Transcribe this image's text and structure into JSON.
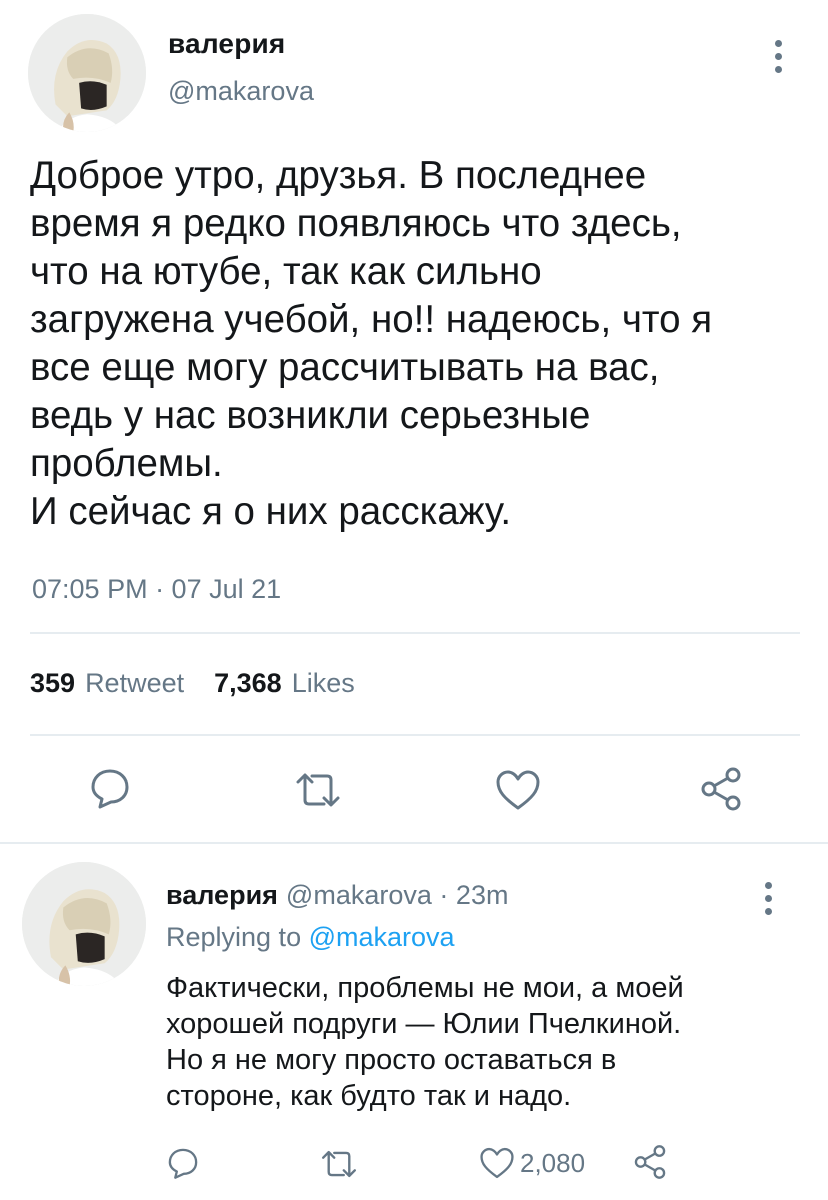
{
  "colors": {
    "text": "#14171a",
    "secondary": "#657786",
    "accent": "#1da1f2",
    "divider": "#e6ecf0"
  },
  "main_tweet": {
    "author_name": "валерия",
    "author_handle": "@makarova",
    "text": "Доброе утро, друзья. В последнее\nвремя я редко появляюсь что здесь,\nчто на ютубе, так как сильно\nзагружена учебой, но!! надеюсь, что я\nвсе еще могу рассчитывать на вас,\nведь у нас возникли серьезные\nпроблемы.\nИ сейчас я о них расскажу.",
    "timestamp": "07:05 PM · 07 Jul 21",
    "retweet_count": "359",
    "retweet_label": "Retweet",
    "like_count": "7,368",
    "like_label": "Likes",
    "icons": [
      "more-vertical-icon",
      "reply-icon",
      "retweet-icon",
      "like-icon",
      "share-icon"
    ]
  },
  "reply_tweet": {
    "author_name": "валерия",
    "author_handle": "@makarova",
    "separator": "·",
    "time_ago": "23m",
    "replying_prefix": "Replying to",
    "replying_to": "@makarova",
    "text": "Фактически, проблемы не мои, а моей\nхорошей подруги — Юлии Пчелкиной.\nНо я не могу просто оставаться в\nстороне, как будто так и надо.",
    "like_count": "2,080",
    "icons": [
      "more-vertical-icon",
      "reply-icon",
      "retweet-icon",
      "like-icon",
      "share-icon"
    ]
  }
}
